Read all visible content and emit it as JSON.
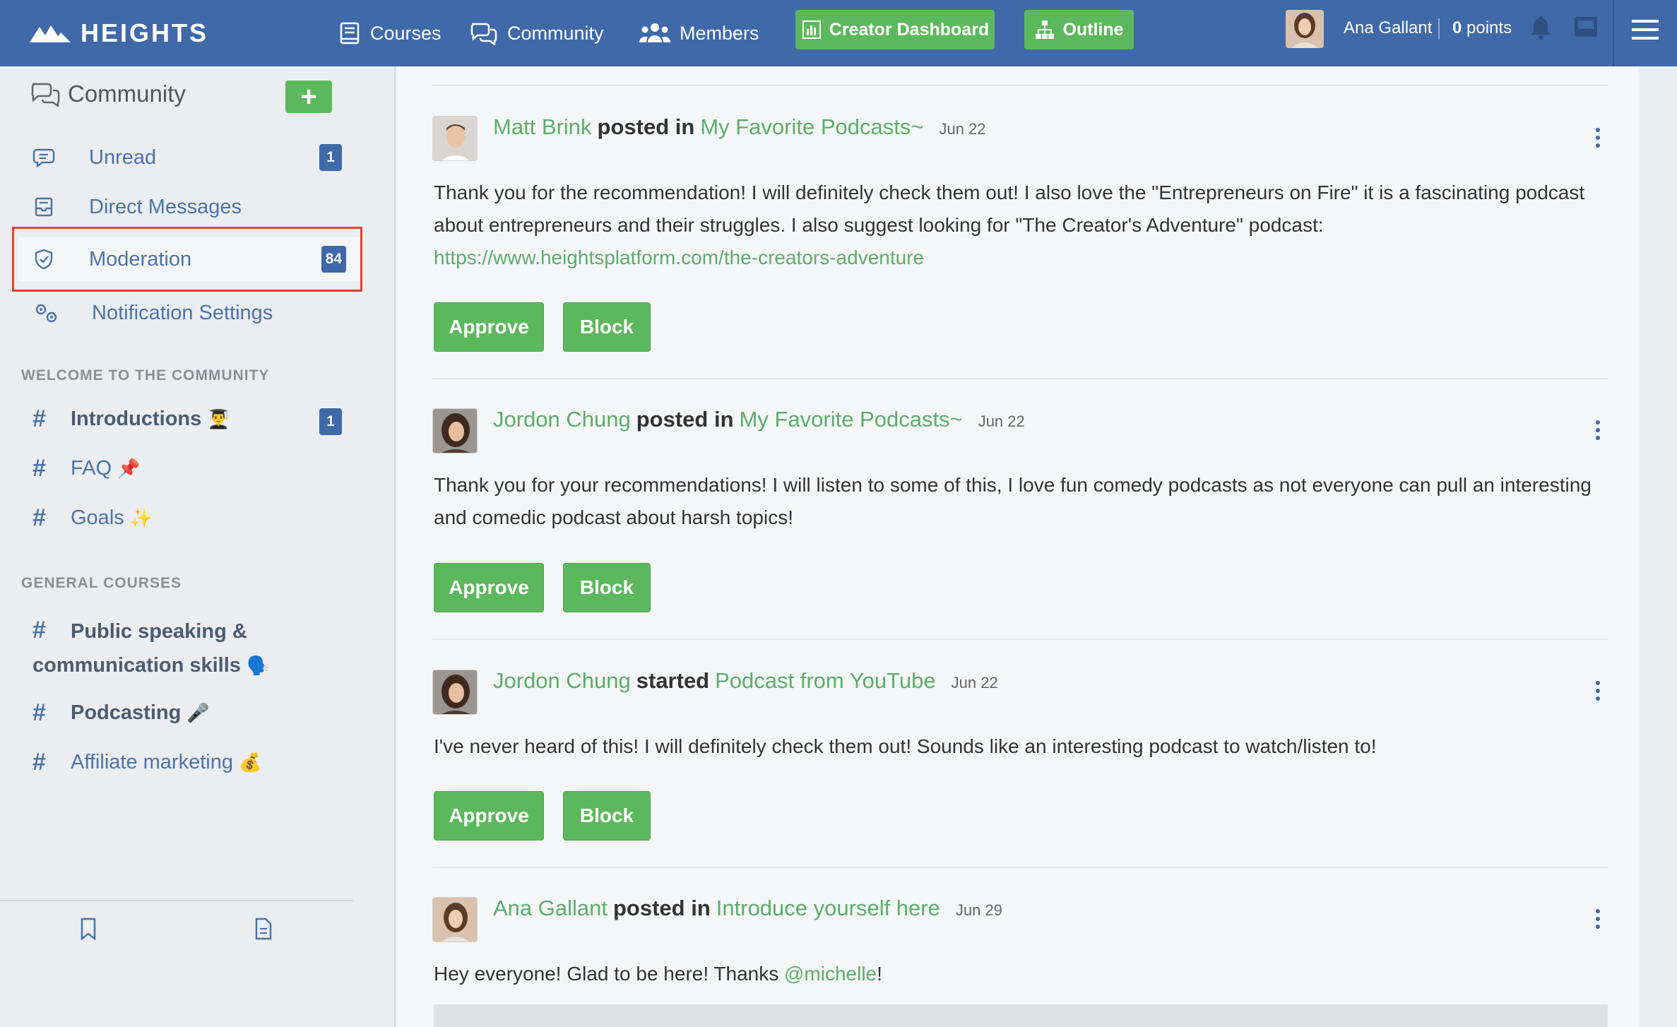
{
  "brand": {
    "name": "HEIGHTS"
  },
  "nav": {
    "courses": "Courses",
    "community": "Community",
    "members": "Members",
    "creator_dashboard": "Creator Dashboard",
    "outline": "Outline"
  },
  "user": {
    "name": "Ana Gallant",
    "points_value": "0",
    "points_label": "points"
  },
  "sidebar": {
    "title": "Community",
    "add_label": "+",
    "items": [
      {
        "label": "Unread",
        "badge": "1"
      },
      {
        "label": "Direct Messages"
      },
      {
        "label": "Moderation",
        "badge": "84"
      },
      {
        "label": "Notification Settings"
      }
    ],
    "sections": [
      {
        "title": "WELCOME TO THE COMMUNITY",
        "channels": [
          {
            "label": "Introductions",
            "emoji": "👨‍🎓",
            "badge": "1"
          },
          {
            "label": "FAQ",
            "emoji": "📌"
          },
          {
            "label": "Goals",
            "emoji": "✨"
          }
        ]
      },
      {
        "title": "GENERAL COURSES",
        "channels": [
          {
            "label": "Public speaking & communication skills",
            "emoji": "🗣️"
          },
          {
            "label": "Podcasting",
            "emoji": "🎤"
          },
          {
            "label": "Affiliate marketing",
            "emoji": "💰"
          }
        ]
      }
    ]
  },
  "posts": [
    {
      "author": "Matt Brink",
      "verb": "posted in",
      "topic": "My Favorite Podcasts~",
      "date": "Jun 22",
      "body_line1": "Thank you for the recommendation! I will definitely check them out! I also love the \"Entrepreneurs on Fire\" it is a fascinating podcast",
      "body_line2": "about entrepreneurs and their struggles. I also suggest looking for \"The Creator's Adventure\" podcast:",
      "link": "https://www.heightsplatform.com/the-creators-adventure"
    },
    {
      "author": "Jordon Chung",
      "verb": "posted in",
      "topic": "My Favorite Podcasts~",
      "date": "Jun 22",
      "body_line1": "Thank you for your recommendations! I will listen to some of this, I love fun comedy podcasts as not everyone can pull an interesting",
      "body_line2": "and comedic podcast about harsh topics!"
    },
    {
      "author": "Jordon Chung",
      "verb": "started",
      "topic": "Podcast from YouTube",
      "date": "Jun 22",
      "body_line1": "I've never heard of this! I will definitely check them out! Sounds like an interesting podcast to watch/listen to!"
    },
    {
      "author": "Ana Gallant",
      "verb": "posted in",
      "topic": "Introduce yourself here",
      "date": "Jun 29",
      "body_pre": "Hey everyone! Glad to be here! Thanks ",
      "mention": "@michelle",
      "body_post": "!"
    }
  ],
  "actions": {
    "approve": "Approve",
    "block": "Block"
  },
  "colors": {
    "topbar": "#3f69a9",
    "accent_green": "#5cb85c",
    "link_green": "#5cae6a",
    "highlight": "#e0432f"
  }
}
